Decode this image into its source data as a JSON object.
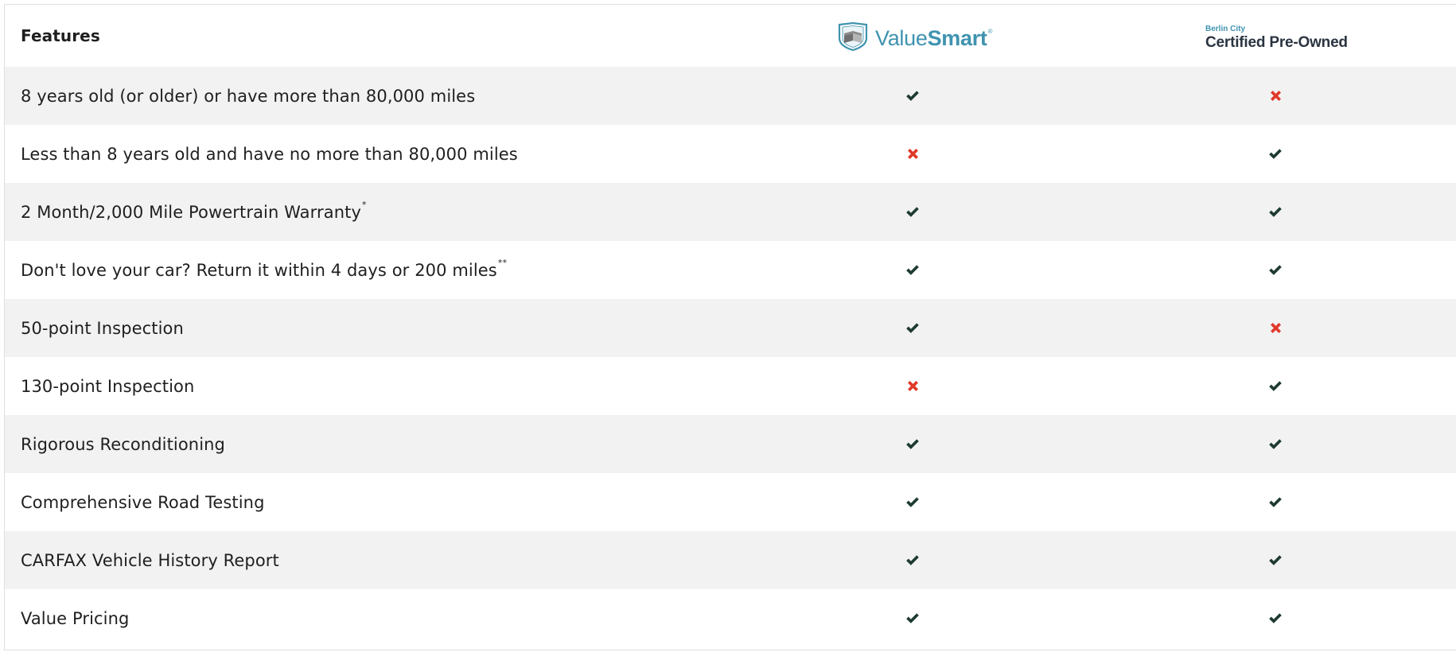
{
  "header": {
    "features_label": "Features",
    "valuesmart": {
      "light": "Value",
      "bold": "Smart",
      "tm": "®",
      "icon": "shield-icon"
    },
    "cpo": {
      "small": "Berlin City",
      "main": "Certified Pre-Owned"
    }
  },
  "icons": {
    "yes": "check-icon",
    "no": "cross-icon"
  },
  "colors": {
    "check": "#1e3a32",
    "cross": "#e03a2a",
    "brand": "#3f93b0",
    "row_alt": "#f2f2f2"
  },
  "rows": [
    {
      "feature": "8 years old (or older) or have more than 80,000 miles",
      "sup": "",
      "valuesmart": true,
      "cpo": false
    },
    {
      "feature": "Less than 8 years old and have no more than 80,000 miles",
      "sup": "",
      "valuesmart": false,
      "cpo": true
    },
    {
      "feature": "2 Month/2,000 Mile Powertrain Warranty",
      "sup": "*",
      "valuesmart": true,
      "cpo": true
    },
    {
      "feature": "Don't love your car? Return it within 4 days or 200 miles",
      "sup": "**",
      "valuesmart": true,
      "cpo": true
    },
    {
      "feature": "50-point Inspection",
      "sup": "",
      "valuesmart": true,
      "cpo": false
    },
    {
      "feature": "130-point Inspection",
      "sup": "",
      "valuesmart": false,
      "cpo": true
    },
    {
      "feature": "Rigorous Reconditioning",
      "sup": "",
      "valuesmart": true,
      "cpo": true
    },
    {
      "feature": "Comprehensive Road Testing",
      "sup": "",
      "valuesmart": true,
      "cpo": true
    },
    {
      "feature": "CARFAX Vehicle History Report",
      "sup": "",
      "valuesmart": true,
      "cpo": true
    },
    {
      "feature": "Value Pricing",
      "sup": "",
      "valuesmart": true,
      "cpo": true
    }
  ]
}
